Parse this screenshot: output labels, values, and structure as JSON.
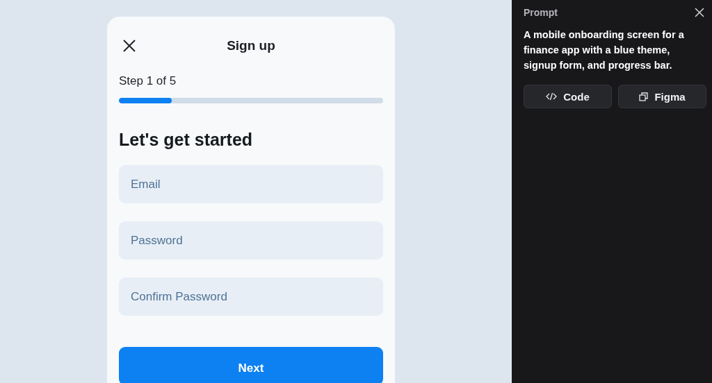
{
  "signup": {
    "title": "Sign up",
    "step": "Step 1 of 5",
    "progress": {
      "level": 0.2
    },
    "heading": "Let's get started",
    "fields": [
      {
        "placeholder": "Email"
      },
      {
        "placeholder": "Password"
      },
      {
        "placeholder": "Confirm Password"
      }
    ],
    "button": "Next"
  },
  "prompt_panel": {
    "label": "Prompt",
    "text": "A mobile onboarding screen for a finance app with a blue theme, signup form, and progress bar.",
    "buttons": [
      {
        "kind": "code",
        "label": "Code"
      },
      {
        "kind": "figma",
        "label": "Figma"
      }
    ]
  }
}
